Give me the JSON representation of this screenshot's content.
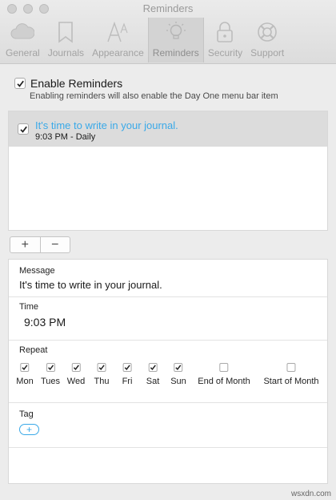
{
  "window": {
    "title": "Reminders"
  },
  "toolbar": {
    "items": [
      {
        "label": "General",
        "icon": "cloud-icon"
      },
      {
        "label": "Journals",
        "icon": "bookmark-icon"
      },
      {
        "label": "Appearance",
        "icon": "font-icon"
      },
      {
        "label": "Reminders",
        "icon": "lightbulb-icon",
        "active": true
      },
      {
        "label": "Security",
        "icon": "lock-icon"
      },
      {
        "label": "Support",
        "icon": "lifebuoy-icon"
      }
    ]
  },
  "enable": {
    "label": "Enable Reminders",
    "checked": true,
    "note": "Enabling reminders will also enable the Day One menu bar item"
  },
  "reminders": [
    {
      "message": "It's time to write in your journal.",
      "schedule": "9:03 PM - Daily",
      "checked": true,
      "selected": true
    }
  ],
  "list_buttons": {
    "add": "+",
    "remove": "−"
  },
  "detail": {
    "message_label": "Message",
    "message_value": "It's time to write in your journal.",
    "time_label": "Time",
    "time_value": "9:03 PM",
    "repeat_label": "Repeat",
    "days": [
      {
        "label": "Mon",
        "checked": true
      },
      {
        "label": "Tues",
        "checked": true
      },
      {
        "label": "Wed",
        "checked": true
      },
      {
        "label": "Thu",
        "checked": true
      },
      {
        "label": "Fri",
        "checked": true
      },
      {
        "label": "Sat",
        "checked": true
      },
      {
        "label": "Sun",
        "checked": true
      },
      {
        "label": "End of Month",
        "checked": false
      },
      {
        "label": "Start of Month",
        "checked": false
      }
    ],
    "tag_label": "Tag",
    "tag_add": "+"
  },
  "watermark": "wsxdn.com",
  "colors": {
    "accent": "#3aa9e8",
    "selection": "#dcdcdc",
    "window_bg": "#ececec"
  }
}
